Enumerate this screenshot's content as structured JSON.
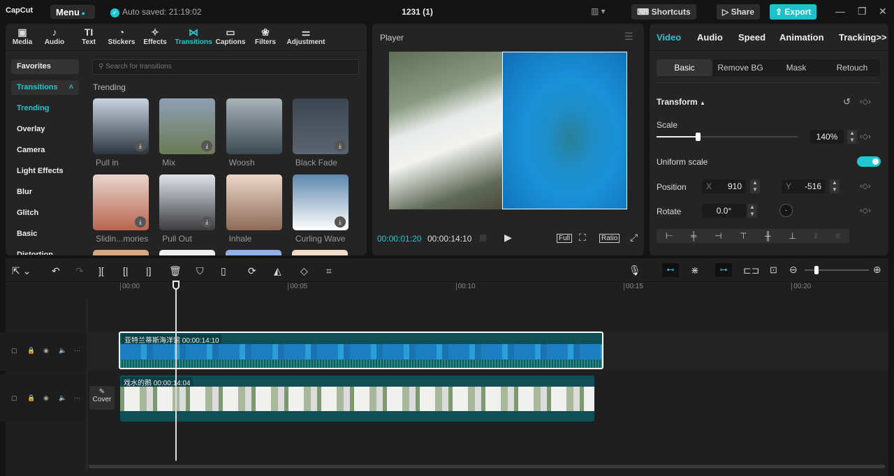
{
  "app": {
    "logo": "CapCut",
    "menu": "Menu",
    "autosave": "Auto saved: 21:19:02",
    "project_title": "1231 (1)",
    "shortcuts": "Shortcuts",
    "share": "Share",
    "export": "Export"
  },
  "tool_tabs": [
    {
      "label": "Media",
      "icon": "▣"
    },
    {
      "label": "Audio",
      "icon": "♪"
    },
    {
      "label": "Text",
      "icon": "TI"
    },
    {
      "label": "Stickers",
      "icon": "◔"
    },
    {
      "label": "Effects",
      "icon": "✧"
    },
    {
      "label": "Transitions",
      "icon": "⋈"
    },
    {
      "label": "Captions",
      "icon": "▭"
    },
    {
      "label": "Filters",
      "icon": "❀"
    },
    {
      "label": "Adjustment",
      "icon": "⚌"
    }
  ],
  "sidebar": {
    "favorites": "Favorites",
    "transitions": "Transitions",
    "items": [
      "Trending",
      "Overlay",
      "Camera",
      "Light Effects",
      "Blur",
      "Glitch",
      "Basic",
      "Distortion"
    ]
  },
  "search_placeholder": "Search for transitions",
  "section_title": "Trending",
  "transitions": [
    {
      "name": "Pull in",
      "colors": [
        "#c9d4de",
        "#2d3640"
      ]
    },
    {
      "name": "Mix",
      "colors": [
        "#8ea0b4",
        "#6b7a55"
      ]
    },
    {
      "name": "Woosh",
      "colors": [
        "#aab3b8",
        "#3b4a52"
      ]
    },
    {
      "name": "Black Fade",
      "colors": [
        "#3d4650",
        "#5b6470"
      ]
    },
    {
      "name": "Slidin...mories",
      "colors": [
        "#e8d5cc",
        "#b9654e"
      ]
    },
    {
      "name": "Pull Out",
      "colors": [
        "#dfe4ea",
        "#3d3c3f"
      ]
    },
    {
      "name": "Inhale",
      "colors": [
        "#ecd8c8",
        "#8d6a57"
      ]
    },
    {
      "name": "Curling Wave",
      "colors": [
        "#5d88ad",
        "#ffffff"
      ]
    }
  ],
  "player": {
    "title": "Player",
    "current_time": "00:00:01:20",
    "total_time": "00:00:14:10",
    "full": "Full",
    "ratio": "Ratio"
  },
  "right_panel": {
    "tabs": [
      "Video",
      "Audio",
      "Speed",
      "Animation",
      "Tracking>>"
    ],
    "subtabs": [
      "Basic",
      "Remove BG",
      "Mask",
      "Retouch"
    ],
    "transform": "Transform",
    "scale_label": "Scale",
    "scale_value": "140%",
    "scale_fraction": 0.29,
    "uniform_scale": "Uniform scale",
    "uniform_on": true,
    "position_label": "Position",
    "x_label": "X",
    "x_value": "910",
    "y_label": "Y",
    "y_value": "-516",
    "rotate_label": "Rotate",
    "rotate_value": "0.0°"
  },
  "timeline": {
    "ticks": [
      "00:00",
      "00:05",
      "00:10",
      "00:15",
      "00:20"
    ],
    "playhead_seconds": 1.67,
    "clips": [
      {
        "name": "亚特兰蒂斯海洋馆",
        "duration": "00:00:14:10"
      },
      {
        "name": "戏水的鹅",
        "duration": "00:00:14:04"
      }
    ],
    "cover": "Cover"
  },
  "colors": {
    "accent": "#1ec8d0",
    "clip": "#0f4f55"
  }
}
